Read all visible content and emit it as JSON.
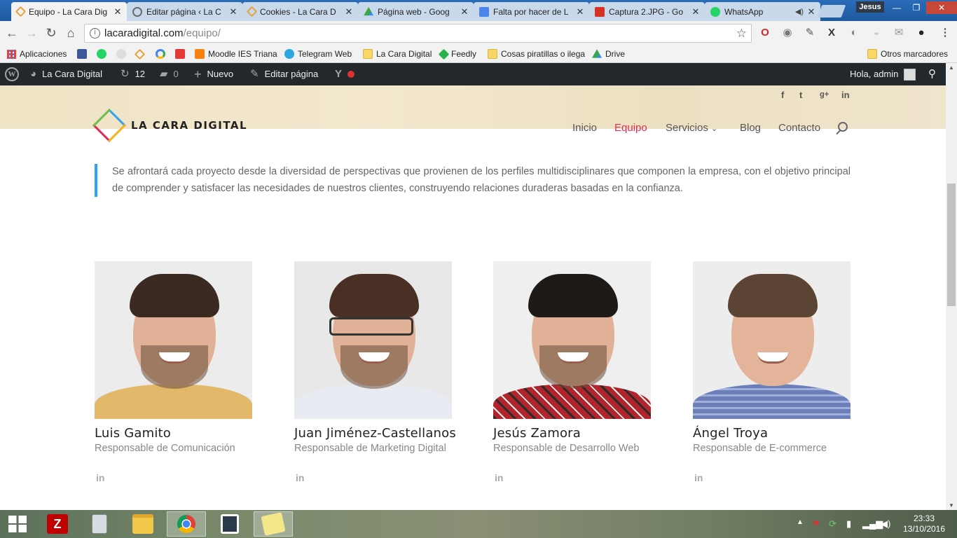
{
  "browser": {
    "tabs": [
      {
        "title": "Equipo - La Cara Dig",
        "active": true,
        "color": "#e8a13a"
      },
      {
        "title": "Editar página ‹ La C",
        "active": false,
        "color": "#6c6c6c"
      },
      {
        "title": "Cookies - La Cara D",
        "active": false,
        "color": "#e8a13a"
      },
      {
        "title": "Página web - Goog",
        "active": false,
        "color": "#3d8b3d"
      },
      {
        "title": "Falta por hacer de L",
        "active": false,
        "color": "#4a86e8"
      },
      {
        "title": "Captura 2.JPG - Go",
        "active": false,
        "color": "#d93025"
      },
      {
        "title": "WhatsApp",
        "active": false,
        "color": "#25d366"
      }
    ],
    "user": "Jesus",
    "url_host": "lacaradigital.com",
    "url_path": "/equipo/"
  },
  "bookmarks": [
    {
      "label": "Aplicaciones",
      "icon": "apps-grid-icon",
      "color": "#e94235"
    },
    {
      "label": "",
      "icon": "facebook-icon",
      "color": "#3b5998"
    },
    {
      "label": "",
      "icon": "whatsapp-icon",
      "color": "#25d366"
    },
    {
      "label": "",
      "icon": "bookmark-icon",
      "color": "#999999"
    },
    {
      "label": "",
      "icon": "lacaradigital-icon",
      "color": "#e8a13a"
    },
    {
      "label": "",
      "icon": "google-icon",
      "color": "#4285f4"
    },
    {
      "label": "",
      "icon": "f-red-icon",
      "color": "#e53935"
    },
    {
      "label": "Moodle IES Triana",
      "icon": "moodle-icon",
      "color": "#f98012"
    },
    {
      "label": "Telegram Web",
      "icon": "telegram-icon",
      "color": "#2ca5e0"
    },
    {
      "label": "La Cara Digital",
      "icon": "folder-icon",
      "color": "#f7d768"
    },
    {
      "label": "Feedly",
      "icon": "feedly-icon",
      "color": "#2bb24c"
    },
    {
      "label": "Cosas piratillas o ilega",
      "icon": "folder-icon",
      "color": "#f7d768"
    },
    {
      "label": "Drive",
      "icon": "drive-icon",
      "color": "#fbbc05"
    }
  ],
  "other_bookmarks": "Otros marcadores",
  "wpbar": {
    "site_name": "La Cara Digital",
    "updates": "12",
    "comments": "0",
    "new": "Nuevo",
    "edit": "Editar página",
    "greeting": "Hola, admin"
  },
  "site": {
    "logo_text": "LA CARA DIGITAL",
    "menu": [
      "Inicio",
      "Equipo",
      "Servicios",
      "Blog",
      "Contacto"
    ],
    "active_menu": "Equipo",
    "quote": "Se afrontará cada proyecto desde la diversidad de perspectivas que provienen de los perfiles multidisciplinares que componen la empresa, con el objetivo principal de comprender y satisfacer las necesidades de nuestros clientes, construyendo relaciones duraderas basadas en la confianza.",
    "accent": "#e02b54",
    "quote_border": "#2ea3f2"
  },
  "team": [
    {
      "name": "Luis Gamito",
      "role": "Responsable de Comunicación",
      "shirt": "#e3b86a",
      "bg": "#eeeeee"
    },
    {
      "name": "Juan Jiménez-Castellanos",
      "role": "Responsable de Marketing Digital",
      "shirt": "#e8ecf2",
      "bg": "#eaeaea"
    },
    {
      "name": "Jesús Zamora",
      "role": "Responsable de Desarrollo Web",
      "shirt": "#b2242b",
      "bg": "#efefef"
    },
    {
      "name": "Ángel Troya",
      "role": "Responsable de E-commerce",
      "shirt": "#6d7fb8",
      "bg": "#eeeeee"
    }
  ],
  "taskbar": {
    "time": "23:33",
    "date": "13/10/2016"
  }
}
